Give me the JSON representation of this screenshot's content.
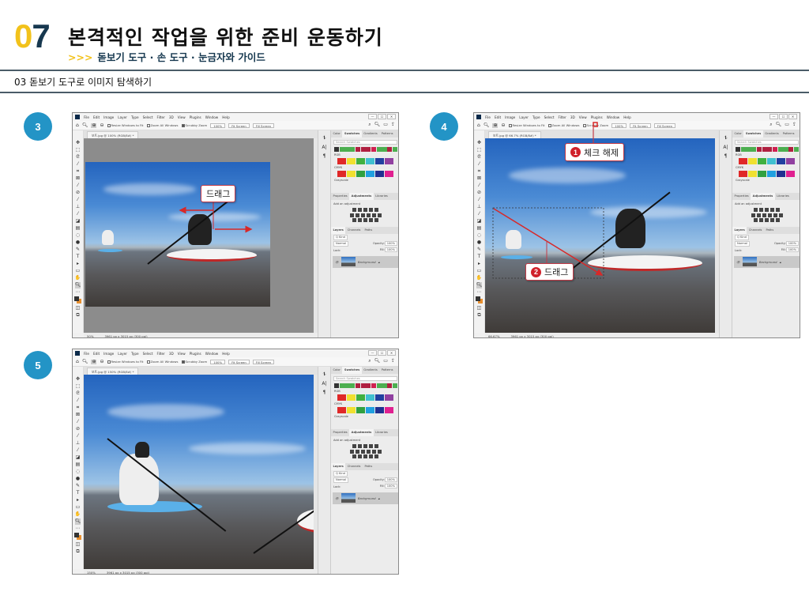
{
  "header": {
    "chapter_digit_1": "0",
    "chapter_digit_2": "7",
    "title": "본격적인 작업을 위한 준비 운동하기",
    "sub_arrows": ">>>",
    "subtitle": "돋보기 도구 · 손 도구 · 눈금자와 가이드",
    "section": "03 돋보기 도구로 이미지 탐색하기"
  },
  "colors": {
    "accent_yellow": "#f2c21b",
    "navy": "#17384f",
    "step_blue": "#2394c6",
    "callout_red": "#d0202a"
  },
  "photoshop": {
    "menus": [
      "File",
      "Edit",
      "Image",
      "Layer",
      "Type",
      "Select",
      "Filter",
      "3D",
      "View",
      "Plugins",
      "Window",
      "Help"
    ],
    "window_controls": [
      "—",
      "☐",
      "✕"
    ],
    "options": {
      "checkboxes": [
        "Resize Windows to Fit",
        "Zoom All Windows",
        "Scrubby Zoom"
      ],
      "buttons": [
        "100%",
        "Fit Screen",
        "Fill Screen"
      ]
    },
    "swatch_tabs": [
      "Color",
      "Swatches",
      "Gradients",
      "Patterns"
    ],
    "search_placeholder": "Search Swatches",
    "swatch_groups": [
      "RGB",
      "CMYK",
      "Grayscale"
    ],
    "recent_swatches": [
      "#333333",
      "#4caf50",
      "#4caf50",
      "#4caf50",
      "#b02040",
      "#b02040",
      "#b02040",
      "#d02050",
      "#4caf50",
      "#4caf50",
      "#b02040",
      "#4caf50"
    ],
    "rgb_swatches": [
      "#e02828",
      "#f0e030",
      "#40b040",
      "#40c0d0",
      "#2040a0",
      "#9040a0"
    ],
    "cmyk_swatches": [
      "#e02828",
      "#f0e030",
      "#30a040",
      "#20a0e0",
      "#203090",
      "#e02090"
    ],
    "props_tabs": [
      "Properties",
      "Adjustments",
      "Libraries"
    ],
    "add_adjustment": "Add an adjustment",
    "layers_tabs": [
      "Layers",
      "Channels",
      "Paths"
    ],
    "kind": "Q Kind",
    "blend_mode": "Normal",
    "opacity_label": "Opacity:",
    "opacity_value": "100%",
    "lock_label": "Lock:",
    "fill_label": "Fill:",
    "fill_value": "100%",
    "layer_name": "Background",
    "doc_size": "3961 px x 3015 px (300 ppi)"
  },
  "steps": [
    {
      "number": "3",
      "tab": "보트.jpg @ 100% (RGB/8#) *",
      "zoom": "50%",
      "callouts": [
        {
          "badge": "",
          "text": "드래그"
        }
      ]
    },
    {
      "number": "4",
      "tab": "보트.jpg @ 66.7% (RGB/8#) *",
      "zoom": "66.67%",
      "callouts": [
        {
          "badge": "1",
          "text": "체크 해제"
        },
        {
          "badge": "2",
          "text": "드래그"
        }
      ]
    },
    {
      "number": "5",
      "tab": "보트.jpg @ 150% (RGB/8#) *",
      "zoom": "150%",
      "callouts": []
    }
  ]
}
